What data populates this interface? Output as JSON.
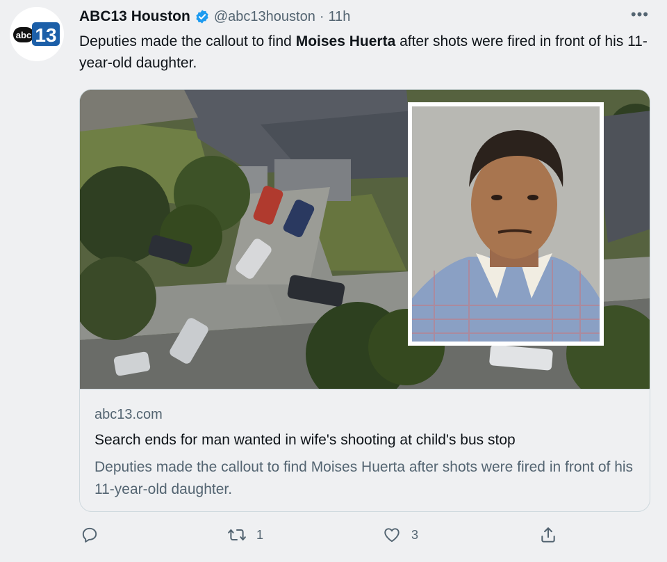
{
  "tweet": {
    "author_name": "ABC13 Houston",
    "handle": "@abc13houston",
    "separator": "·",
    "time": "11h",
    "more": "•••",
    "text_before": "Deputies made the callout to find ",
    "text_bold": "Moises Huerta",
    "text_after": " after shots were fired in front of his 11-year-old daughter."
  },
  "avatar": {
    "logo_left": "abc",
    "logo_right": "13"
  },
  "card": {
    "domain": "abc13.com",
    "title": "Search ends for man wanted in wife's shooting at child's bus stop",
    "description": "Deputies made the callout to find Moises Huerta after shots were fired in front of his 11-year-old daughter."
  },
  "actions": {
    "reply_icon": "reply-icon",
    "retweet_icon": "retweet-icon",
    "retweet_count": "1",
    "like_icon": "heart-icon",
    "like_count": "3",
    "share_icon": "share-icon"
  },
  "colors": {
    "verified": "#1d9bf0",
    "abc_blue": "#1c5fa8",
    "text": "#0f1419",
    "muted": "#536471"
  }
}
